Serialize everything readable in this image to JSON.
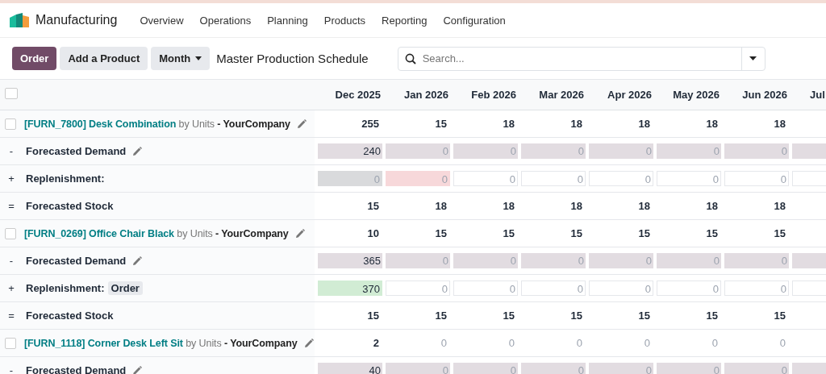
{
  "navbar": {
    "app_name": "Manufacturing",
    "menu": [
      "Overview",
      "Operations",
      "Planning",
      "Products",
      "Reporting",
      "Configuration"
    ]
  },
  "control_panel": {
    "buttons": [
      {
        "label": "Order",
        "kind": "primary"
      },
      {
        "label": "Add a Product",
        "kind": "secondary"
      }
    ],
    "period": "Month",
    "title": "Master Production Schedule",
    "search": {
      "placeholder": "Search..."
    }
  },
  "table": {
    "select_all": {
      "checked": false
    },
    "columns": [
      "Dec 2025",
      "Jan 2026",
      "Feb 2026",
      "Mar 2026",
      "Apr 2026",
      "May 2026",
      "Jun 2026",
      "Jul"
    ],
    "rows": [
      {
        "kind": "product",
        "checked": false,
        "code": "[FURN_7800] Desk Combination",
        "uom": "by Units",
        "company": "- YourCompany",
        "cells": [
          {
            "value": "255",
            "muted": false
          },
          {
            "value": "15",
            "muted": false
          },
          {
            "value": "18",
            "muted": false
          },
          {
            "value": "18",
            "muted": false
          },
          {
            "value": "18",
            "muted": false
          },
          {
            "value": "18",
            "muted": false
          },
          {
            "value": "18",
            "muted": false
          }
        ]
      },
      {
        "kind": "demand",
        "sign": "-",
        "label": "Forecasted Demand",
        "cells": [
          {
            "value": "240",
            "muted": false
          },
          {
            "value": "0",
            "muted": true
          },
          {
            "value": "0",
            "muted": true
          },
          {
            "value": "0",
            "muted": true
          },
          {
            "value": "0",
            "muted": true
          },
          {
            "value": "0",
            "muted": true
          },
          {
            "value": "0",
            "muted": true
          }
        ]
      },
      {
        "kind": "replenishment",
        "sign": "+",
        "label": "Replenishment:",
        "cells": [
          {
            "value": "0",
            "muted": true,
            "color": "#d9dadc"
          },
          {
            "value": "0",
            "muted": true,
            "color": "#f7d8da"
          },
          {
            "value": "0",
            "muted": true,
            "color": "#ffffff"
          },
          {
            "value": "0",
            "muted": true,
            "color": "#ffffff"
          },
          {
            "value": "0",
            "muted": true,
            "color": "#ffffff"
          },
          {
            "value": "0",
            "muted": true,
            "color": "#ffffff"
          },
          {
            "value": "0",
            "muted": true,
            "color": "#ffffff"
          }
        ]
      },
      {
        "kind": "stock",
        "sign": "=",
        "label": "Forecasted Stock",
        "cells": [
          {
            "value": "15",
            "muted": false
          },
          {
            "value": "18",
            "muted": false
          },
          {
            "value": "18",
            "muted": false
          },
          {
            "value": "18",
            "muted": false
          },
          {
            "value": "18",
            "muted": false
          },
          {
            "value": "18",
            "muted": false
          },
          {
            "value": "18",
            "muted": false
          }
        ]
      },
      {
        "kind": "product",
        "checked": false,
        "code": "[FURN_0269] Office Chair Black",
        "uom": "by Units",
        "company": "- YourCompany",
        "cells": [
          {
            "value": "10",
            "muted": false
          },
          {
            "value": "15",
            "muted": false
          },
          {
            "value": "15",
            "muted": false
          },
          {
            "value": "15",
            "muted": false
          },
          {
            "value": "15",
            "muted": false
          },
          {
            "value": "15",
            "muted": false
          },
          {
            "value": "15",
            "muted": false
          }
        ]
      },
      {
        "kind": "demand",
        "sign": "-",
        "label": "Forecasted Demand",
        "cells": [
          {
            "value": "365",
            "muted": false
          },
          {
            "value": "0",
            "muted": true
          },
          {
            "value": "0",
            "muted": true
          },
          {
            "value": "0",
            "muted": true
          },
          {
            "value": "0",
            "muted": true
          },
          {
            "value": "0",
            "muted": true
          },
          {
            "value": "0",
            "muted": true
          }
        ]
      },
      {
        "kind": "replenishment",
        "sign": "+",
        "label": "Replenishment:",
        "badge": "Order",
        "cells": [
          {
            "value": "370",
            "muted": false,
            "color": "#d1ecd4"
          },
          {
            "value": "0",
            "muted": true,
            "color": "#ffffff"
          },
          {
            "value": "0",
            "muted": true,
            "color": "#ffffff"
          },
          {
            "value": "0",
            "muted": true,
            "color": "#ffffff"
          },
          {
            "value": "0",
            "muted": true,
            "color": "#ffffff"
          },
          {
            "value": "0",
            "muted": true,
            "color": "#ffffff"
          },
          {
            "value": "0",
            "muted": true,
            "color": "#ffffff"
          }
        ]
      },
      {
        "kind": "stock",
        "sign": "=",
        "label": "Forecasted Stock",
        "cells": [
          {
            "value": "15",
            "muted": false
          },
          {
            "value": "15",
            "muted": false
          },
          {
            "value": "15",
            "muted": false
          },
          {
            "value": "15",
            "muted": false
          },
          {
            "value": "15",
            "muted": false
          },
          {
            "value": "15",
            "muted": false
          },
          {
            "value": "15",
            "muted": false
          }
        ]
      },
      {
        "kind": "product",
        "checked": false,
        "code": "[FURN_1118] Corner Desk Left Sit",
        "uom": "by Units",
        "company": "- YourCompany",
        "cells": [
          {
            "value": "2",
            "muted": false
          },
          {
            "value": "0",
            "muted": true
          },
          {
            "value": "0",
            "muted": true
          },
          {
            "value": "0",
            "muted": true
          },
          {
            "value": "0",
            "muted": true
          },
          {
            "value": "0",
            "muted": true
          },
          {
            "value": "0",
            "muted": true
          }
        ]
      },
      {
        "kind": "demand",
        "sign": "-",
        "label": "Forecasted Demand",
        "cells": [
          {
            "value": "40",
            "muted": false
          },
          {
            "value": "0",
            "muted": true
          },
          {
            "value": "0",
            "muted": true
          },
          {
            "value": "0",
            "muted": true
          },
          {
            "value": "0",
            "muted": true
          },
          {
            "value": "0",
            "muted": true
          },
          {
            "value": "0",
            "muted": true
          }
        ]
      }
    ]
  }
}
